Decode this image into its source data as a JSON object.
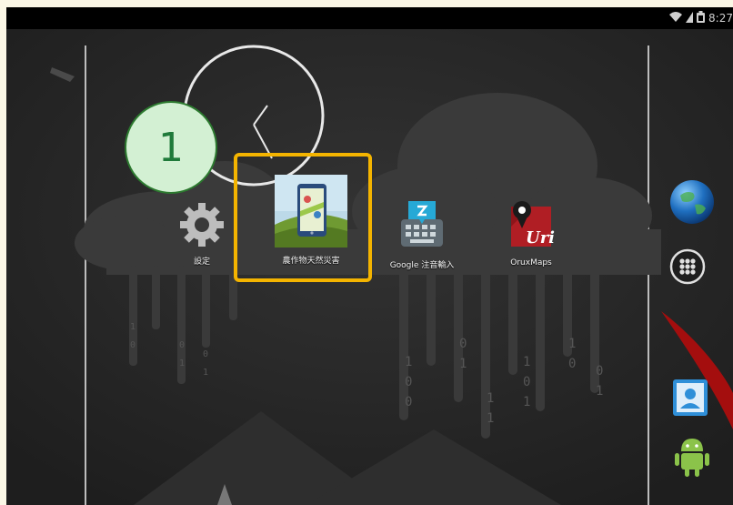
{
  "status_bar": {
    "time": "8:27",
    "icons": [
      "wifi-icon",
      "signal-icon",
      "battery-icon"
    ]
  },
  "annotation": {
    "step_number": "1",
    "badge_color": "#d3f0d3",
    "highlight_color": "#f4b400"
  },
  "home_screen": {
    "apps": [
      {
        "label": "設定",
        "icon": "settings-gear-icon"
      },
      {
        "label": "農作物天然災害",
        "icon": "crop-disaster-map-app-icon"
      },
      {
        "label": "Google 注音輸入",
        "icon": "google-zhuyin-keyboard-icon"
      },
      {
        "label": "OruxMaps",
        "icon": "oruxmaps-icon"
      }
    ]
  },
  "dock": {
    "items": [
      "browser-globe-icon",
      "app-drawer-icon",
      "contacts-icon",
      "android-icon"
    ]
  },
  "wallpaper": {
    "binary_rain_text": "1 0 0 1 1 1 0 1 0 1 1 0 1 0 0 1 1 1 0 1"
  }
}
